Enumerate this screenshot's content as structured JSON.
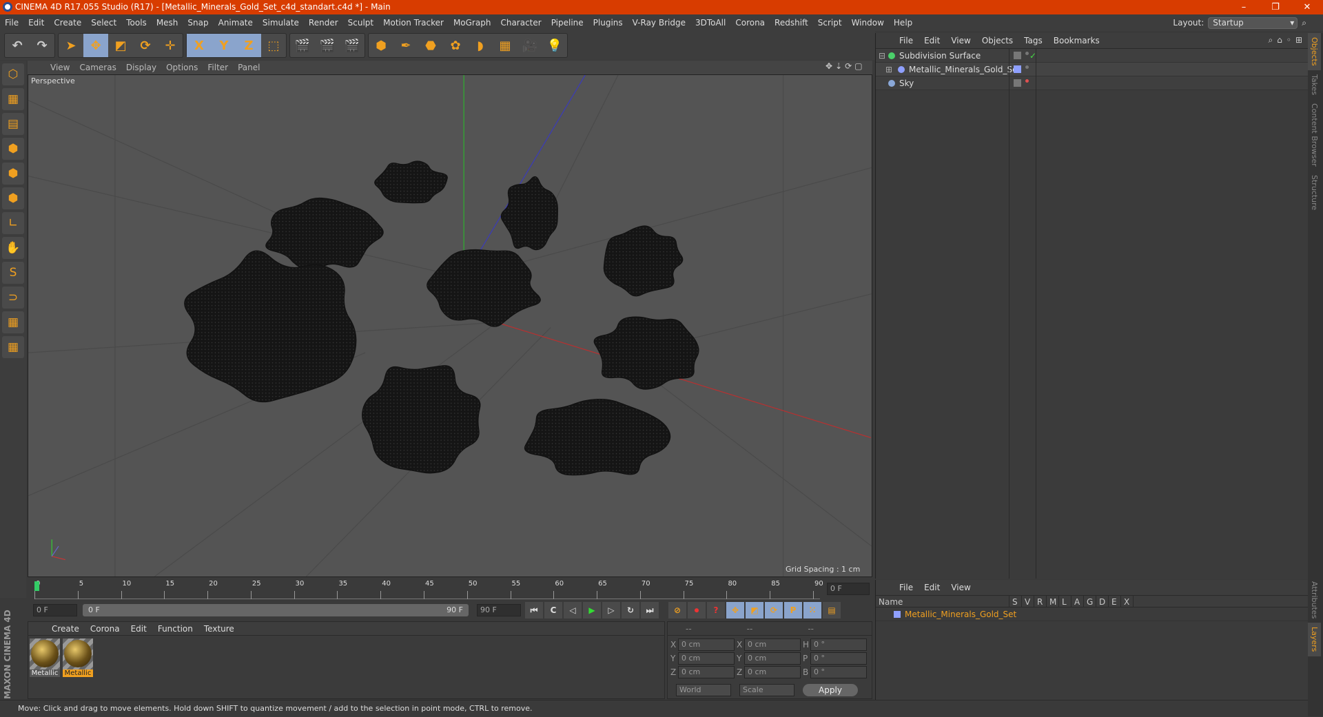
{
  "title": "CINEMA 4D R17.055 Studio (R17) - [Metallic_Minerals_Gold_Set_c4d_standart.c4d *] - Main",
  "window_controls": [
    "–",
    "❐",
    "✕"
  ],
  "menu": [
    "File",
    "Edit",
    "Create",
    "Select",
    "Tools",
    "Mesh",
    "Snap",
    "Animate",
    "Simulate",
    "Render",
    "Sculpt",
    "Motion Tracker",
    "MoGraph",
    "Character",
    "Pipeline",
    "Plugins",
    "V-Ray Bridge",
    "3DToAll",
    "Corona",
    "Redshift",
    "Script",
    "Window",
    "Help"
  ],
  "layout": {
    "label": "Layout:",
    "value": "Startup"
  },
  "toolbar": [
    {
      "name": "undo-icon",
      "glyph": "↶"
    },
    {
      "name": "redo-icon",
      "glyph": "↷"
    },
    {
      "name": "select-icon",
      "glyph": "➤"
    },
    {
      "name": "move-icon",
      "glyph": "✥",
      "on": true
    },
    {
      "name": "scale-icon",
      "glyph": "◩"
    },
    {
      "name": "rotate-icon",
      "glyph": "⟳"
    },
    {
      "name": "move-axis-icon",
      "glyph": "✛"
    },
    {
      "name": "x-axis-icon",
      "glyph": "X",
      "on": true
    },
    {
      "name": "y-axis-icon",
      "glyph": "Y",
      "on": true
    },
    {
      "name": "z-axis-icon",
      "glyph": "Z",
      "on": true
    },
    {
      "name": "coordinate-system-icon",
      "glyph": "⬚"
    },
    {
      "name": "render-view-icon",
      "glyph": "🎬"
    },
    {
      "name": "render-picture-viewer-icon",
      "glyph": "🎬"
    },
    {
      "name": "render-settings-icon",
      "glyph": "🎬"
    },
    {
      "name": "cube-icon",
      "glyph": "⬢"
    },
    {
      "name": "pen-icon",
      "glyph": "✒"
    },
    {
      "name": "subdivision-icon",
      "glyph": "⬣"
    },
    {
      "name": "cloner-icon",
      "glyph": "✿"
    },
    {
      "name": "deformer-icon",
      "glyph": "◗"
    },
    {
      "name": "floor-icon",
      "glyph": "▦"
    },
    {
      "name": "camera-icon",
      "glyph": "🎥"
    },
    {
      "name": "light-icon",
      "glyph": "💡"
    }
  ],
  "left_tools": [
    "⬡",
    "▦",
    "▤",
    "⬢",
    "⬢",
    "⬢",
    "∟",
    "✋",
    "S",
    "⊃",
    "▦",
    "▦"
  ],
  "viewport": {
    "menu": [
      "View",
      "Cameras",
      "Display",
      "Options",
      "Filter",
      "Panel"
    ],
    "label": "Perspective",
    "grid_spacing": "Grid Spacing : 1 cm",
    "nav_icons": [
      "✥",
      "⇣",
      "⟳",
      "▢"
    ]
  },
  "objects": {
    "menu": [
      "File",
      "Edit",
      "View",
      "Objects",
      "Tags",
      "Bookmarks"
    ],
    "items": [
      {
        "name": "Subdivision Surface",
        "color": "#4bd06a",
        "expand": "⊟",
        "check": "✓"
      },
      {
        "name": "Metallic_Minerals_Gold_Set",
        "color": "#8fa0ff",
        "expand": "⊞",
        "indent": 1
      },
      {
        "name": "Sky",
        "color": "#8aa8d8",
        "dot": "#e05050"
      }
    ]
  },
  "side_tabs": [
    "Objects",
    "Takes",
    "Content Browser",
    "Structure"
  ],
  "side_tabs_bottom": [
    "Attributes",
    "Layers"
  ],
  "timeline": {
    "ticks": [
      "0",
      "5",
      "10",
      "15",
      "20",
      "25",
      "30",
      "35",
      "40",
      "45",
      "50",
      "55",
      "60",
      "65",
      "70",
      "75",
      "80",
      "85",
      "90"
    ],
    "current": "0 F",
    "start": "0 F",
    "range_start": "0 F",
    "range_end": "90 F",
    "end": "90 F"
  },
  "transport": [
    "⏮",
    "C",
    "◁",
    "▶",
    "▷",
    "↻",
    "⏭"
  ],
  "transport2": [
    "⊘",
    "⏺",
    "?",
    "✥",
    "◩",
    "⟳",
    "P",
    "⁙",
    "▤"
  ],
  "materials": {
    "menu": [
      "Create",
      "Corona",
      "Edit",
      "Function",
      "Texture"
    ],
    "items": [
      "Metallic",
      "Metallic"
    ]
  },
  "coords": {
    "header": [
      "--",
      "--",
      "--"
    ],
    "rows": [
      [
        "X",
        "0 cm",
        "X",
        "0 cm",
        "H",
        "0 °"
      ],
      [
        "Y",
        "0 cm",
        "Y",
        "0 cm",
        "P",
        "0 °"
      ],
      [
        "Z",
        "0 cm",
        "Z",
        "0 cm",
        "B",
        "0 °"
      ]
    ],
    "mode": "World",
    "type": "Scale",
    "apply": "Apply"
  },
  "layers": {
    "menu": [
      "File",
      "Edit",
      "View"
    ],
    "columns": [
      "Name",
      "S",
      "V",
      "R",
      "M",
      "L",
      "A",
      "G",
      "D",
      "E",
      "X"
    ],
    "items": [
      {
        "name": "Metallic_Minerals_Gold_Set",
        "color": "#8fa0ff"
      }
    ]
  },
  "brand": "MAXON CINEMA 4D",
  "status": "Move: Click and drag to move elements. Hold down SHIFT to quantize movement / add to the selection in point mode, CTRL to remove.",
  "colors": {
    "titlebar": "#d83c00",
    "accent": "#f0a020",
    "selected_material": "#f0a020"
  }
}
